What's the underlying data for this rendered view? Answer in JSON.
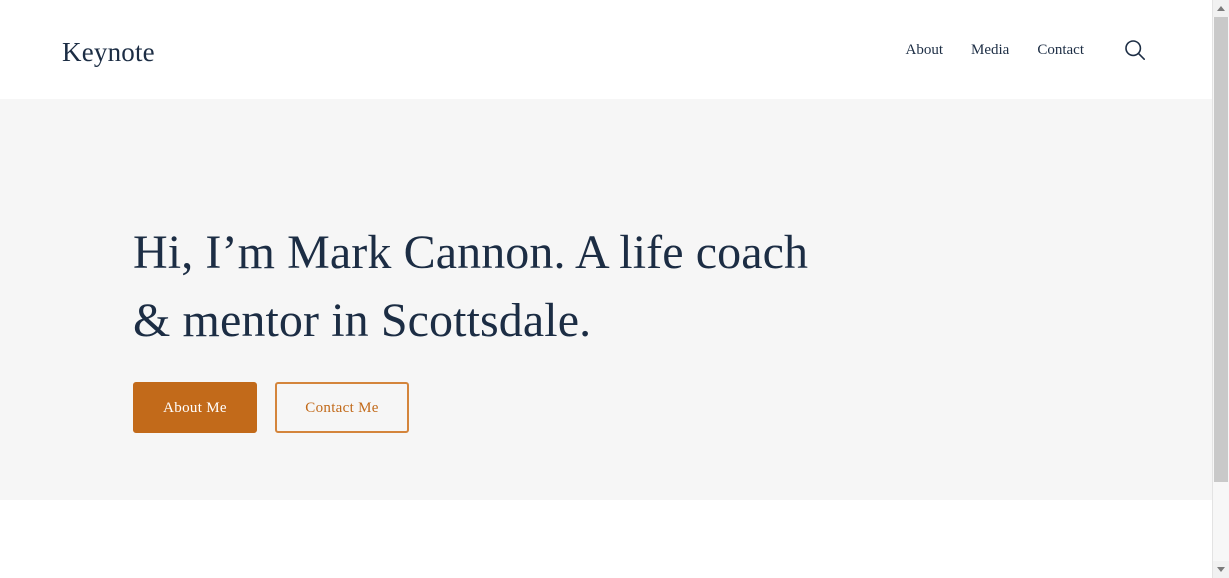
{
  "site": {
    "brand": "Keynote",
    "colors": {
      "navy": "#1c2d44",
      "orange": "#c26a1a",
      "orange_border": "#d4853c",
      "hero_background": "#f6f6f6",
      "header_background": "#ffffff"
    }
  },
  "header": {
    "brand_label": "Keynote",
    "nav": [
      {
        "label": "About"
      },
      {
        "label": "Media"
      },
      {
        "label": "Contact"
      }
    ],
    "search_icon": "search-icon"
  },
  "hero": {
    "title": "Hi, I’m Mark Cannon. A life coach & mentor in Scottsdale.",
    "buttons": [
      {
        "label": "About Me",
        "style": "primary"
      },
      {
        "label": "Contact Me",
        "style": "outline"
      }
    ]
  },
  "scrollbar": {
    "up_arrow_icon": "chevron-up-icon",
    "down_arrow_icon": "chevron-down-icon"
  }
}
